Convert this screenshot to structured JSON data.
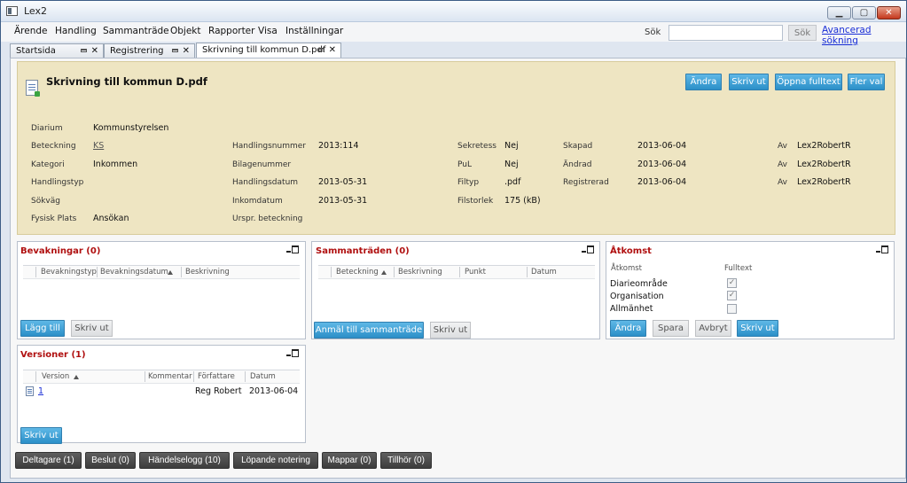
{
  "window": {
    "title": "Lex2"
  },
  "menu": [
    "Ärende",
    "Handling",
    "Sammanträde",
    "Objekt",
    "Rapporter",
    "Visa",
    "Inställningar"
  ],
  "search": {
    "label": "Sök",
    "value": "",
    "placeholder": "",
    "button": "Sök",
    "advanced_link": "Avancerad sökning"
  },
  "tabs": [
    {
      "label": "Startsida",
      "active": false
    },
    {
      "label": "Registrering",
      "active": false
    },
    {
      "label": "Skrivning till kommun D.pdf",
      "active": true
    }
  ],
  "document": {
    "title": "Skrivning till kommun D.pdf",
    "buttons": {
      "edit": "Ändra",
      "print": "Skriv ut",
      "open_fulltext": "Öppna fulltext",
      "more": "Fler val"
    },
    "col1": [
      {
        "label": "Diarium",
        "value": "Kommunstyrelsen"
      },
      {
        "label": "Beteckning",
        "value": "KS"
      },
      {
        "label": "Kategori",
        "value": "Inkommen"
      },
      {
        "label": "Handlingstyp",
        "value": ""
      },
      {
        "label": "Sökväg",
        "value": ""
      },
      {
        "label": "Fysisk Plats",
        "value": "Ansökan"
      }
    ],
    "col2": [
      {
        "label": "Handlingsnummer",
        "value": "2013:114"
      },
      {
        "label": "Bilagenummer",
        "value": ""
      },
      {
        "label": "Handlingsdatum",
        "value": "2013-05-31"
      },
      {
        "label": "Inkomdatum",
        "value": "2013-05-31"
      },
      {
        "label": "Urspr. beteckning",
        "value": ""
      }
    ],
    "col3": [
      {
        "label": "Sekretess",
        "value": "Nej"
      },
      {
        "label": "PuL",
        "value": "Nej"
      },
      {
        "label": "Filtyp",
        "value": ".pdf"
      },
      {
        "label": "Filstorlek",
        "value": "175 (kB)"
      }
    ],
    "col4": [
      {
        "label": "Skapad",
        "date": "2013-06-04",
        "by_label": "Av",
        "by": "Lex2RobertR"
      },
      {
        "label": "Ändrad",
        "date": "2013-06-04",
        "by_label": "Av",
        "by": "Lex2RobertR"
      },
      {
        "label": "Registrerad",
        "date": "2013-06-04",
        "by_label": "Av",
        "by": "Lex2RobertR"
      }
    ]
  },
  "bevakningar": {
    "title": "Bevakningar (0)",
    "columns": [
      "Bevakningstyp",
      "Bevakningsdatum",
      "Beskrivning"
    ],
    "add_button": "Lägg till",
    "print_button": "Skriv ut"
  },
  "sammantraden": {
    "title": "Sammanträden (0)",
    "columns": [
      "Beteckning",
      "Beskrivning",
      "Punkt",
      "Datum"
    ],
    "register_button": "Anmäl till sammanträde",
    "print_button": "Skriv ut"
  },
  "atkomst": {
    "title": "Åtkomst",
    "col_access": "Åtkomst",
    "col_fulltext": "Fulltext",
    "rows": [
      {
        "label": "Diarieområde",
        "fulltext": true
      },
      {
        "label": "Organisation",
        "fulltext": true
      },
      {
        "label": "Allmänhet",
        "fulltext": false
      }
    ],
    "buttons": {
      "edit": "Ändra",
      "save": "Spara",
      "cancel": "Avbryt",
      "print": "Skriv ut"
    }
  },
  "versioner": {
    "title": "Versioner (1)",
    "columns": [
      "Version",
      "Kommentar",
      "Författare",
      "Datum"
    ],
    "rows": [
      {
        "version": "1",
        "comment": "",
        "author": "Reg Robert",
        "date": "2013-06-04"
      }
    ],
    "print_button": "Skriv ut"
  },
  "bottom_tabs": [
    "Deltagare (1)",
    "Beslut (0)",
    "Händelselogg (10)",
    "Löpande notering",
    "Mappar (0)",
    "Tillhör (0)"
  ],
  "colors": {
    "accent_blue": "#2b8fc8",
    "panel_title_red": "#b01010",
    "doc_panel_bg": "#eee5c2"
  }
}
